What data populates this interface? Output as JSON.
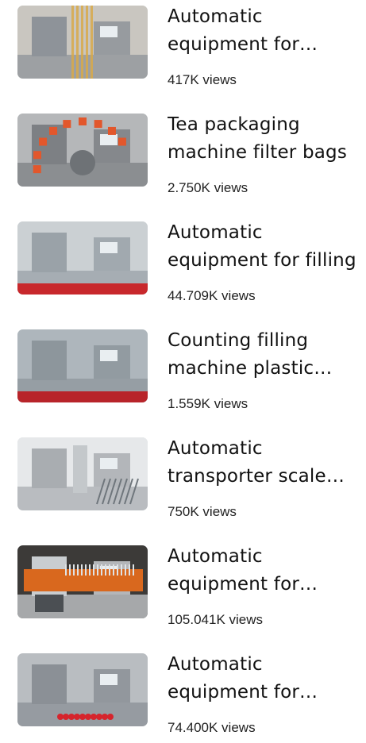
{
  "videos": [
    {
      "title": "Automatic equipment for packaging",
      "views": "417K views",
      "thumbnail": "automatic-packaging-line-image",
      "colors": {
        "bg": "#c9c6c0",
        "machine": "#8e9399",
        "accent": "#d8a94a"
      }
    },
    {
      "title": "Tea packaging machine filter bags",
      "views": "2.750K views",
      "thumbnail": "tea-packaging-wheel-image",
      "colors": {
        "bg": "#b5b7b9",
        "machine": "#7d8084",
        "accent": "#e2572c"
      }
    },
    {
      "title": "Automatic equipment for filling",
      "views": "44.709K views",
      "thumbnail": "filling-machine-exhibition-image",
      "colors": {
        "bg": "#cbd0d3",
        "machine": "#9aa2a8",
        "accent": "#c8282c"
      }
    },
    {
      "title": "Counting filling machine plastic bottles",
      "views": "1.559K views",
      "thumbnail": "counting-filling-machine-image",
      "colors": {
        "bg": "#aeb6bc",
        "machine": "#8d969c",
        "accent": "#b8242a"
      }
    },
    {
      "title": "Automatic transporter scale weighing",
      "views": "750K views",
      "thumbnail": "transporter-scale-image",
      "colors": {
        "bg": "#e6e8ea",
        "machine": "#a9adb1",
        "accent": "#6f767c"
      }
    },
    {
      "title": "Automatic equipment for bottling",
      "views": "105.041K views",
      "thumbnail": "orange-conveyor-machine-image",
      "colors": {
        "bg": "#3c3a38",
        "machine": "#c9cdd0",
        "accent": "#d9681e"
      }
    },
    {
      "title": "Automatic equipment for capping",
      "views": "74.400K views",
      "thumbnail": "bottle-capping-machine-image",
      "colors": {
        "bg": "#b9bdc1",
        "machine": "#8b9096",
        "accent": "#d6242c"
      }
    }
  ]
}
